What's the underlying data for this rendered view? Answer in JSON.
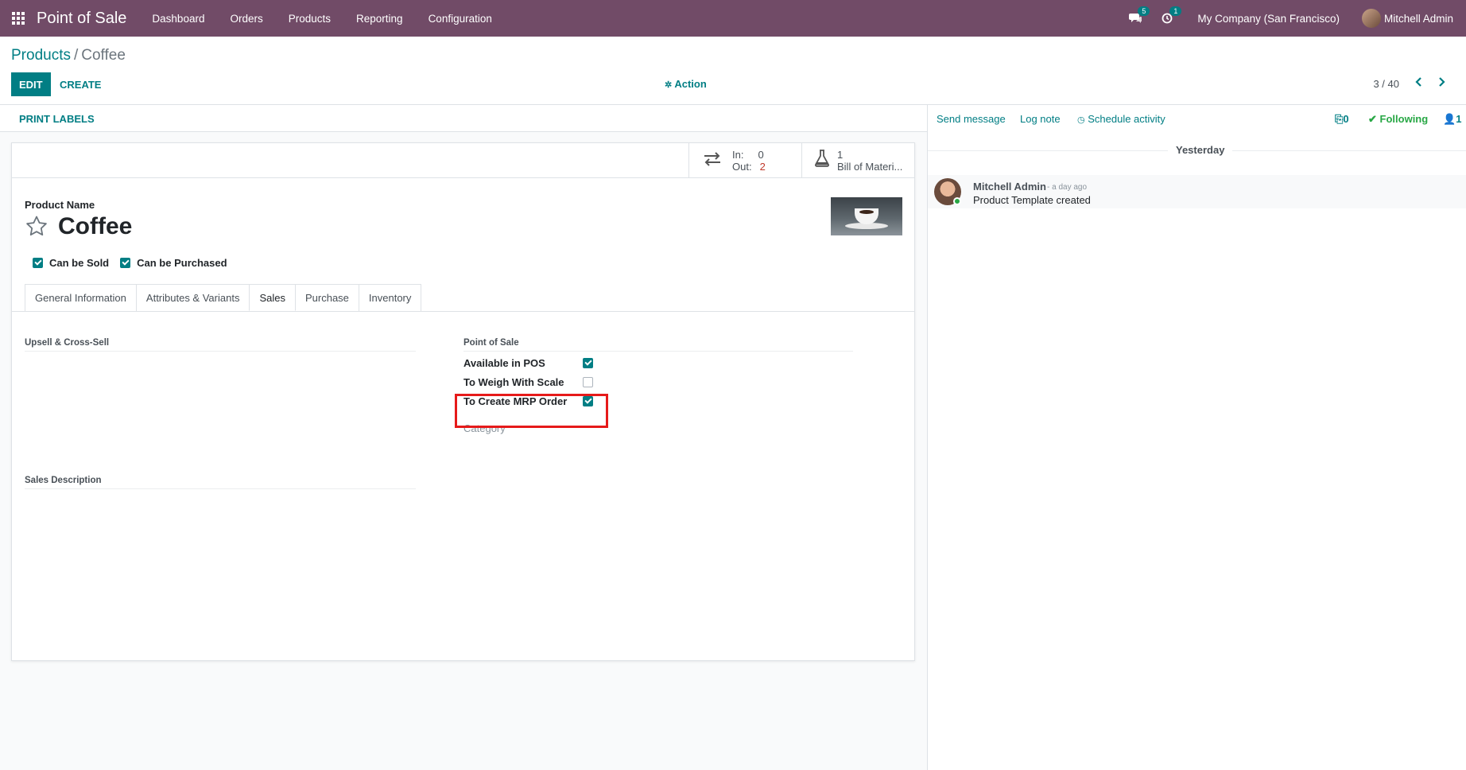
{
  "navbar": {
    "brand": "Point of Sale",
    "menu": [
      "Dashboard",
      "Orders",
      "Products",
      "Reporting",
      "Configuration"
    ],
    "messages_count": "5",
    "activities_count": "1",
    "company": "My Company (San Francisco)",
    "user": "Mitchell Admin"
  },
  "control": {
    "breadcrumb_parent": "Products",
    "breadcrumb_sep": "/",
    "breadcrumb_current": "Coffee",
    "edit": "EDIT",
    "create": "CREATE",
    "action": "Action",
    "pager": "3 / 40"
  },
  "form": {
    "print_labels": "PRINT LABELS",
    "moves_in_label": "In:",
    "moves_in": "0",
    "moves_out_label": "Out:",
    "moves_out": "2",
    "bom_count": "1",
    "bom_label": "Bill of Materi...",
    "product_name_label": "Product Name",
    "product_name": "Coffee",
    "can_be_sold": "Can be Sold",
    "can_be_purchased": "Can be Purchased",
    "tabs": [
      "General Information",
      "Attributes & Variants",
      "Sales",
      "Purchase",
      "Inventory"
    ],
    "active_tab": "Sales",
    "upsell_title": "Upsell & Cross-Sell",
    "sales_description_title": "Sales Description",
    "pos_title": "Point of Sale",
    "available_in_pos": "Available in POS",
    "to_weigh": "To Weigh With Scale",
    "to_create_mrp": "To Create MRP Order",
    "category": "Category"
  },
  "chatter": {
    "send_message": "Send message",
    "log_note": "Log note",
    "schedule_activity": "Schedule activity",
    "attachments": "0",
    "following": "Following",
    "followers": "1",
    "day": "Yesterday",
    "author": "Mitchell Admin",
    "date": "- a day ago",
    "body": "Product Template created"
  },
  "colors": {
    "navbar": "#714b67",
    "primary": "#017e84",
    "highlight": "#e61a1a"
  }
}
